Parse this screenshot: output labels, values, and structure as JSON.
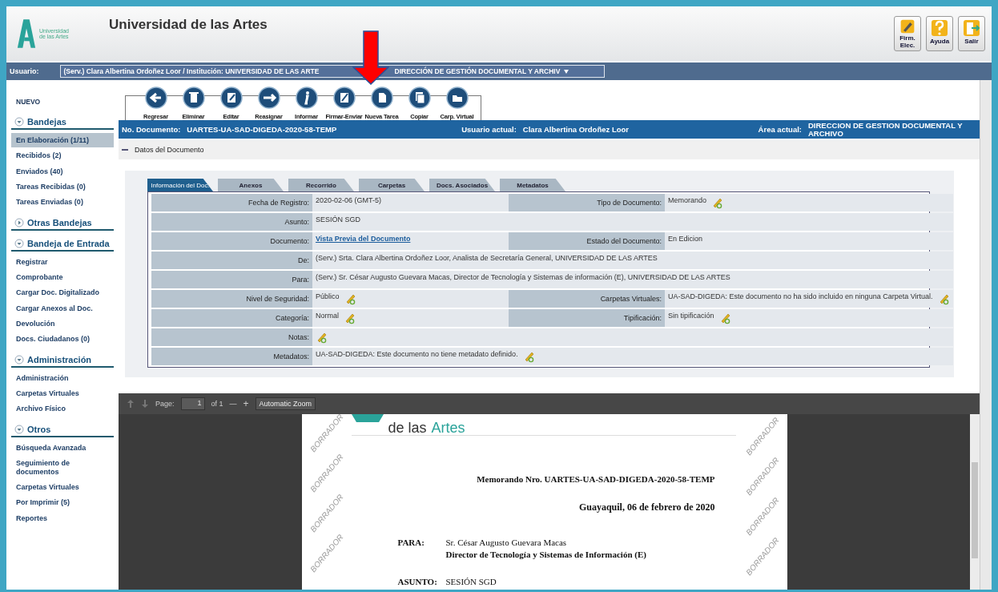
{
  "header": {
    "logo_text": [
      "Universidad",
      "de las Artes"
    ],
    "title": "Universidad de las Artes",
    "buttons": [
      {
        "kind": "sign",
        "label": "Firm. Elec."
      },
      {
        "kind": "help",
        "label": "Ayuda"
      },
      {
        "kind": "exit",
        "label": "Salir"
      }
    ]
  },
  "user_bar": {
    "label": "Usuario:",
    "selection_parts": [
      "(Serv.) Clara Albertina Ordoñez Loor / Institución: UNIVERSIDAD DE LAS ARTE",
      "DIRECCIÓN DE GESTIÓN DOCUMENTAL Y ARCHIV"
    ]
  },
  "sidebar": {
    "new_link": "NUEVO",
    "sections": [
      {
        "title": "Bandejas",
        "expanded": true,
        "items": [
          {
            "label": "En Elaboración (1/11)",
            "selected": true
          },
          {
            "label": "Recibidos (2)",
            "selected": false
          },
          {
            "label": "Enviados (40)",
            "selected": false
          },
          {
            "label": "Tareas Recibidas (0)",
            "selected": false
          },
          {
            "label": "Tareas Enviadas (0)",
            "selected": false
          }
        ]
      },
      {
        "title": "Otras Bandejas",
        "expanded": false
      },
      {
        "title": "Bandeja de Entrada",
        "expanded": true,
        "items": [
          {
            "label": "Registrar",
            "selected": false
          },
          {
            "label": "Comprobante",
            "selected": false
          },
          {
            "label": "Cargar Doc. Digitalizado",
            "selected": false
          },
          {
            "label": "Cargar Anexos al Doc.",
            "selected": false
          },
          {
            "label": "Devolución",
            "selected": false
          },
          {
            "label": "Docs. Ciudadanos (0)",
            "selected": false
          }
        ]
      },
      {
        "title": "Administración",
        "expanded": true,
        "items": [
          {
            "label": "Administración",
            "selected": false
          },
          {
            "label": "Carpetas Virtuales",
            "selected": false
          },
          {
            "label": "Archivo Físico",
            "selected": false
          }
        ]
      },
      {
        "title": "Otros",
        "expanded": true,
        "items": [
          {
            "label": "Búsqueda Avanzada",
            "selected": false
          },
          {
            "label": "Seguimiento de documentos",
            "selected": false
          },
          {
            "label": "Carpetas Virtuales",
            "selected": false
          },
          {
            "label": "Por Imprimir (5)",
            "selected": false
          },
          {
            "label": "Reportes",
            "selected": false
          }
        ]
      }
    ]
  },
  "toolbar": [
    {
      "kind": "back",
      "label": "Regresar"
    },
    {
      "kind": "delete",
      "label": "Eliminar"
    },
    {
      "kind": "edit",
      "label": "Editar"
    },
    {
      "kind": "reassign",
      "label": "Reasignar"
    },
    {
      "kind": "info",
      "label": "Informar"
    },
    {
      "kind": "sign",
      "label": "Firmar-Enviar"
    },
    {
      "kind": "task",
      "label": "Nueva Tarea"
    },
    {
      "kind": "copy",
      "label": "Copiar"
    },
    {
      "kind": "folder",
      "label": "Carp. Virtual"
    }
  ],
  "document_bar": {
    "number_label": "No. Documento:",
    "number": "UARTES-UA-SAD-DIGEDA-2020-58-TEMP",
    "user_label": "Usuario actual:",
    "user": "Clara Albertina Ordoñez Loor",
    "area_label": "Área actual:",
    "area": "DIRECCION DE GESTION DOCUMENTAL Y ARCHIVO"
  },
  "section_title": "Datos del Documento",
  "tabs": [
    {
      "label": "Información del Doc.",
      "selected": true
    },
    {
      "label": "Anexos",
      "selected": false
    },
    {
      "label": "Recorrido",
      "selected": false
    },
    {
      "label": "Carpetas",
      "selected": false
    },
    {
      "label": "Docs. Asociados",
      "selected": false
    },
    {
      "label": "Metadatos",
      "selected": false
    }
  ],
  "details": [
    {
      "kind": "pair",
      "fields": [
        {
          "label": "Fecha de Registro:",
          "value": "2020-02-06 (GMT-5)",
          "editable": false
        },
        {
          "label": "Tipo de Documento:",
          "value": "Memorando",
          "editable": true
        }
      ]
    },
    {
      "kind": "wide",
      "fields": [
        {
          "label": "Asunto:",
          "value": "SESIÓN SGD",
          "editable": false
        }
      ]
    },
    {
      "kind": "pair",
      "fields": [
        {
          "label": "Documento:",
          "value": "Vista Previa del Documento",
          "editable": false,
          "link": true
        },
        {
          "label": "Estado del Documento:",
          "value": "En Edicion",
          "editable": false
        }
      ]
    },
    {
      "kind": "wide",
      "fields": [
        {
          "label": "De:",
          "value": "(Serv.) Srta. Clara Albertina Ordoñez Loor, Analista de Secretaría General, UNIVERSIDAD DE LAS ARTES",
          "editable": false
        }
      ]
    },
    {
      "kind": "wide",
      "fields": [
        {
          "label": "Para:",
          "value": "(Serv.) Sr. César Augusto Guevara Macas, Director de Tecnología y Sistemas de información (E), UNIVERSIDAD DE LAS ARTES",
          "editable": false
        }
      ]
    },
    {
      "kind": "pair",
      "fields": [
        {
          "label": "Nivel de Seguridad:",
          "value": "Público",
          "editable": true
        },
        {
          "label": "Carpetas Virtuales:",
          "value": "UA-SAD-DIGEDA: Este documento no ha sido incluido en ninguna Carpeta Virtual.",
          "editable": true
        }
      ]
    },
    {
      "kind": "pair",
      "fields": [
        {
          "label": "Categoría:",
          "value": "Normal",
          "editable": true
        },
        {
          "label": "Tipificación:",
          "value": "Sin tipificación",
          "editable": true
        }
      ]
    },
    {
      "kind": "wide",
      "fields": [
        {
          "label": "Notas:",
          "editable": true
        }
      ]
    },
    {
      "kind": "wide",
      "fields": [
        {
          "label": "Metadatos:",
          "value": "UA-SAD-DIGEDA: Este documento no tiene metadato definido.",
          "editable": true
        }
      ]
    }
  ],
  "viewer": {
    "page_label": "Page:",
    "page": "1",
    "page_count": "of 1",
    "zoom_out": "—",
    "zoom_in": "+",
    "zoom": "Automatic Zoom",
    "document": {
      "logo_parts": [
        "de las",
        "Artes"
      ],
      "heading": "Memorando Nro. UARTES-UA-SAD-DIGEDA-2020-58-TEMP",
      "date": "Guayaquil, 06 de febrero de 2020",
      "to_label": "PARA:",
      "to_name": "Sr. César Augusto Guevara Macas",
      "to_title": "Director de Tecnología y Sistemas de Información (E)",
      "subject_label": "ASUNTO:",
      "subject": "SESIÓN SGD",
      "draft_marks_left": [
        "BORRADOR",
        "BORRADOR",
        "BORRADOR",
        "BORRADOR"
      ],
      "draft_marks_right": [
        "BORRADOR",
        "BORRADOR",
        "BORRADOR",
        "BORRADOR"
      ]
    }
  }
}
